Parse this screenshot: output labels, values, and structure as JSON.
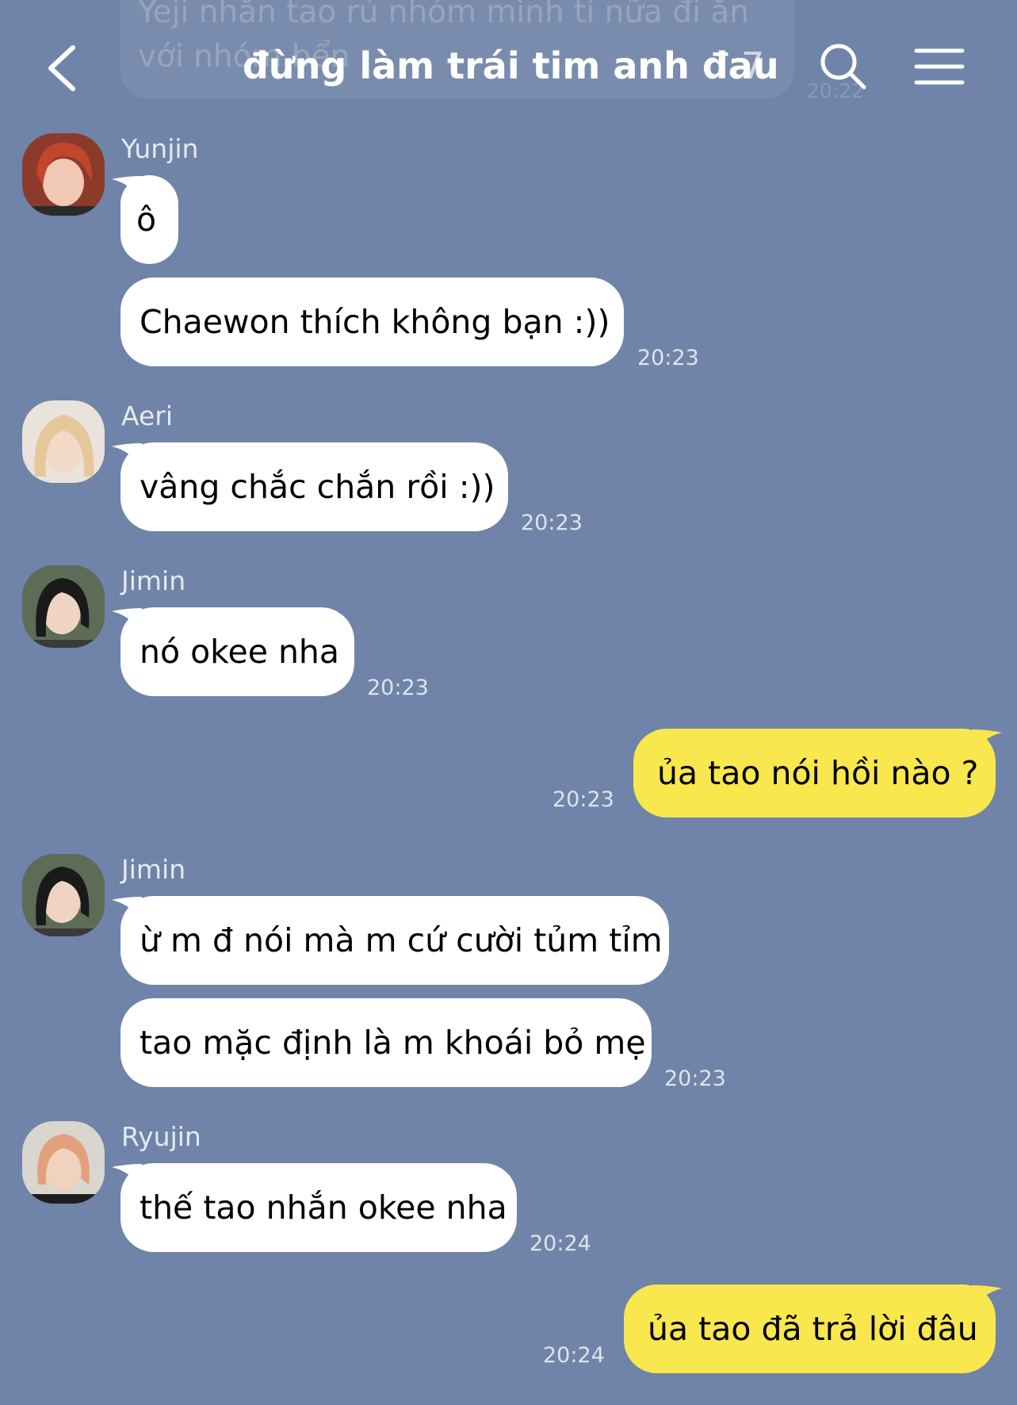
{
  "colors": {
    "background": "#6f84a8",
    "incoming_bubble": "#ffffff",
    "outgoing_bubble": "#f8e74d"
  },
  "previous_message": {
    "text": "Yeji nhắn tao rủ nhóm mình tí nữa đi ăn\nvới nhóm bển",
    "time": "20:22"
  },
  "header": {
    "title": "đừng làm trái tim anh đau",
    "member_count": "7",
    "icons": [
      "back-arrow-icon",
      "search-icon",
      "menu-icon"
    ]
  },
  "messages": [
    {
      "sender": "Yunjin",
      "text": "ô"
    },
    {
      "text": "Chaewon thích không bạn :))",
      "time": "20:23"
    },
    {
      "sender": "Aeri",
      "text": "vâng chắc chắn rồi :))",
      "time": "20:23"
    },
    {
      "sender": "Jimin",
      "text": "nó okee nha",
      "time": "20:23"
    },
    {
      "text": "ủa tao nói hồi nào ?",
      "time": "20:23"
    },
    {
      "sender": "Jimin",
      "text": "ừ m đ nói mà m cứ cười tủm tỉm"
    },
    {
      "text": "tao mặc định là m khoái bỏ mẹ",
      "time": "20:23"
    },
    {
      "sender": "Ryujin",
      "text": "thế tao nhắn okee nha",
      "time": "20:24"
    },
    {
      "text": "ủa tao đã trả lời đâu",
      "time": "20:24"
    }
  ]
}
